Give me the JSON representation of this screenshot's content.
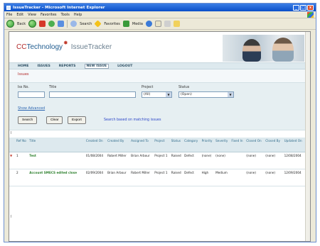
{
  "window": {
    "title": "IssueTracker - Microsoft Internet Explorer",
    "buttons": [
      "_",
      "□",
      "x"
    ]
  },
  "menubar": [
    "File",
    "Edit",
    "View",
    "Favorites",
    "Tools",
    "Help"
  ],
  "toolbar": {
    "back_label": "Back",
    "search_label": "Search",
    "favorites_label": "Favorites",
    "media_label": "Media"
  },
  "logo": {
    "part1": "CC",
    "part2": "Technology",
    "part3": "IssueTracker"
  },
  "nav": [
    "HOME",
    "ISSUES",
    "REPORTS",
    "NEW ISSUE",
    "LOGOUT"
  ],
  "breadcrumb": "Issues",
  "filter": {
    "issue_no_label": "Iss No.",
    "title_label": "Title",
    "project_label": "Project",
    "project_value": "(All)",
    "status_label": "Status",
    "status_value": "(Open)",
    "advanced_link": "Show Advanced",
    "search_button": "Search",
    "clear_button": "Clear",
    "export_button": "Export",
    "help_text": "Search based on matching issues"
  },
  "table": {
    "columns": [
      "Ref No",
      "Title",
      "Created On",
      "Created By",
      "Assigned To",
      "Project",
      "Status",
      "Category",
      "Priority",
      "Severity",
      "Fixed In",
      "Closed On",
      "Closed By",
      "Updated On"
    ],
    "rows": [
      [
        "1",
        "Test",
        "01/08/2004",
        "Robert Miller",
        "Brian Arbour",
        "Project 1",
        "Raised",
        "Defect",
        "(none)",
        "(none)",
        "",
        "(none)",
        "(none)",
        "12/08/2004"
      ],
      [
        "2",
        "Account SMECS edited close",
        "02/09/2004",
        "Brian Arbour",
        "Robert Miller",
        "Project 1",
        "Raised",
        "Defect",
        "High",
        "Medium",
        "",
        "(none)",
        "(none)",
        "12/09/2004"
      ]
    ]
  },
  "colors": {
    "title_bar": "#0a4fc8",
    "nav_bg": "#dde9ee",
    "accent_red": "#b22a2a",
    "link_green": "#2b7f2b"
  }
}
